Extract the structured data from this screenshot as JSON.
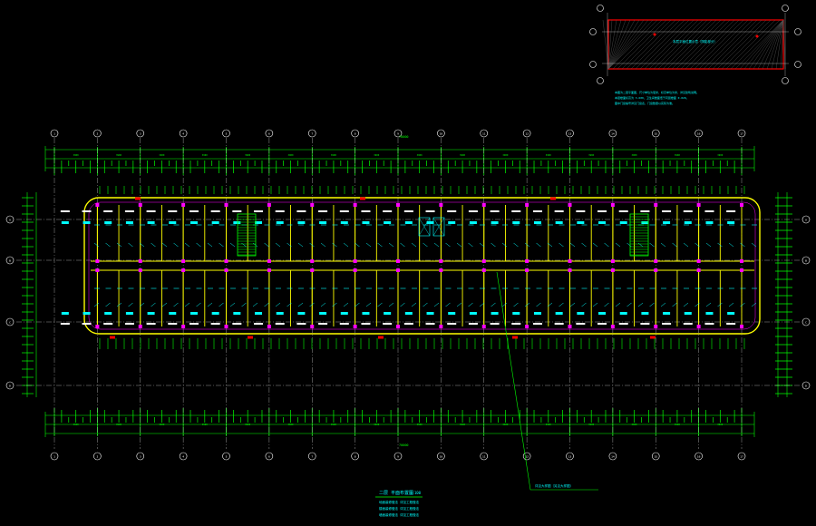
{
  "drawing": {
    "title": "二层 平面布置图",
    "scale": "1:100",
    "notes": [
      "地面装修做法    详见工程做法",
      "楼面装修做法    详见工程做法",
      "墙面装修做法    详见工程做法"
    ],
    "leader_note": "详见大样图（另见大样图）"
  },
  "keyplan": {
    "label": "本层平面位置示意（阴影部分）",
    "notes": [
      "本图为二层平面图，尺寸单位为毫米，标高单位为米，详见建筑说明。",
      "本层楼面标高为 3.600，卫生间楼面低于同层楼面 0.020。",
      "图中门窗编号详见门窗表，门窗数量以实际为准。"
    ]
  },
  "axes": {
    "columns": [
      "1",
      "2",
      "3",
      "4",
      "5",
      "6",
      "7",
      "8",
      "9",
      "10",
      "11",
      "12",
      "13",
      "14",
      "15",
      "16",
      "17"
    ],
    "rows": [
      "A",
      "B",
      "C",
      "D"
    ]
  },
  "dims": {
    "overall": "70000",
    "bay": "3900"
  },
  "colors": {
    "background": "#000000",
    "axis": "#ffffff",
    "wall": "#ffff00",
    "dimension": "#00ff00",
    "text": "#00ffff",
    "column": "#ff00ff",
    "hatch": "#ff0000"
  }
}
